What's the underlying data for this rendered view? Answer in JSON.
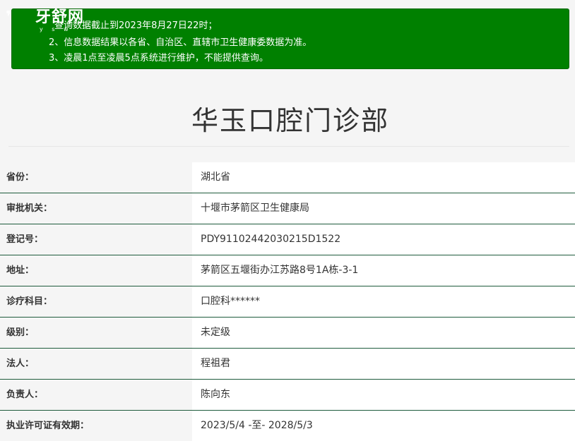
{
  "logo": {
    "mark": "❜",
    "name": "牙舒网",
    "sub": "y s w"
  },
  "notice": {
    "lines": [
      "查询数据截止到2023年8月27日22时；",
      "2、信息数据结果以各省、自治区、直辖市卫生健康委数据为准。",
      "3、凌晨1点至凌晨5点系统进行维护，不能提供查询。"
    ],
    "bg_color": "#008000"
  },
  "page_title": "华玉口腔门诊部",
  "details": [
    {
      "label": "省份：",
      "value": "湖北省"
    },
    {
      "label": "审批机关：",
      "value": "十堰市茅箭区卫生健康局"
    },
    {
      "label": "登记号：",
      "value": "PDY91102442030215D1522"
    },
    {
      "label": "地址：",
      "value": "茅箭区五堰街办江苏路8号1A栋-3-1"
    },
    {
      "label": "诊疗科目：",
      "value": "口腔科******"
    },
    {
      "label": "级别：",
      "value": "未定级"
    },
    {
      "label": "法人：",
      "value": "程祖君"
    },
    {
      "label": "负责人：",
      "value": "陈向东"
    },
    {
      "label": "执业许可证有效期：",
      "value": "2023/5/4 -至- 2028/5/3"
    }
  ]
}
